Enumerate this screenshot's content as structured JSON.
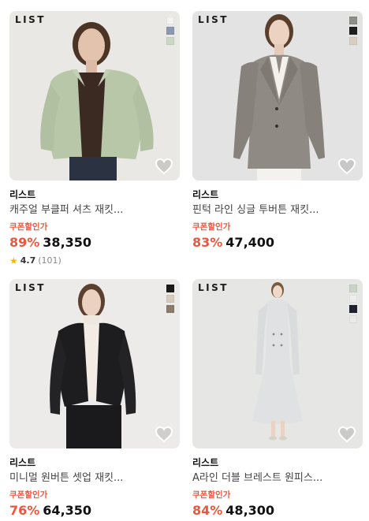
{
  "products": [
    {
      "logo": "LIST",
      "brand": "리스트",
      "name": "캐주얼 부클퍼 셔츠 재킷...",
      "coupon_label": "쿠폰할인가",
      "discount": "89%",
      "price": "38,350",
      "rating": "4.7",
      "review_count": "(101)",
      "background": "#e9e8e4",
      "swatches": [
        "#f2f2f2",
        "#8a98b4",
        "#cdd7c5"
      ]
    },
    {
      "logo": "LIST",
      "brand": "리스트",
      "name": "핀턱 라인 싱글 투버튼 재킷...",
      "coupon_label": "쿠폰할인가",
      "discount": "83%",
      "price": "47,400",
      "background": "#e3e3e3",
      "swatches": [
        "#8c8c88",
        "#1e1e1e",
        "#d8cfc2"
      ]
    },
    {
      "logo": "LIST",
      "brand": "리스트",
      "name": "미니멀 원버튼 셋업 재킷...",
      "coupon_label": "쿠폰할인가",
      "discount": "76%",
      "price": "64,350",
      "background": "#ecebea",
      "swatches": [
        "#1a1a1a",
        "#d6cbbd",
        "#8a7a6a"
      ]
    },
    {
      "logo": "LIST",
      "brand": "리스트",
      "name": "A라인 더블 브레스트 원피스...",
      "coupon_label": "쿠폰할인가",
      "discount": "84%",
      "price": "48,300",
      "background": "#e6e6e4",
      "swatches": [
        "#c9d3c7",
        "#ededed",
        "#1f2230",
        "#e9e9e9"
      ]
    }
  ],
  "colors": {
    "accent": "#f0553b",
    "star": "#f5b800"
  },
  "icons": {
    "wishlist": "heart-icon",
    "rating": "star-icon"
  }
}
